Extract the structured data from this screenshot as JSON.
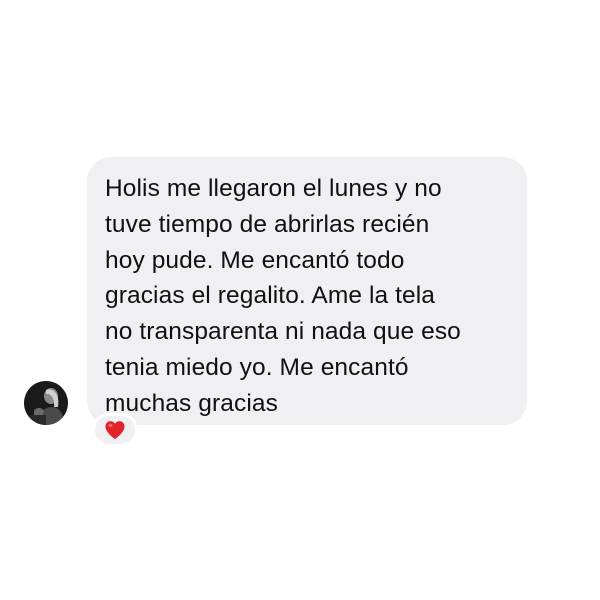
{
  "conversation": {
    "message": {
      "text": "Holis me llegaron el lunes y no\ntuve tiempo de abrirlas recién\nhoy pude. Me encantó todo\ngracias el regalito. Ame la tela\nno transparenta ni nada que eso\ntenia miedo yo. Me encantó\nmuchas gracias",
      "avatar_icon": "user-avatar-photo",
      "reaction_icon": "red-heart-icon",
      "reaction_color": "#e0262b",
      "bubble_color": "#f0f0f3"
    }
  }
}
